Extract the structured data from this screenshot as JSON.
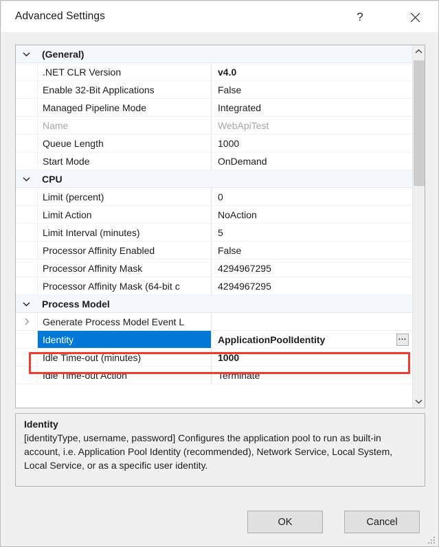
{
  "window": {
    "title": "Advanced Settings",
    "help_icon": "question-mark-icon",
    "close_icon": "close-icon"
  },
  "grid": {
    "rows": [
      {
        "type": "category",
        "expander": "chevron-down",
        "name": "(General)",
        "value": ""
      },
      {
        "type": "property",
        "name": ".NET CLR Version",
        "value": "v4.0",
        "bold": true
      },
      {
        "type": "property",
        "name": "Enable 32-Bit Applications",
        "value": "False"
      },
      {
        "type": "property",
        "name": "Managed Pipeline Mode",
        "value": "Integrated"
      },
      {
        "type": "property",
        "name": "Name",
        "value": "WebApiTest",
        "disabled": true
      },
      {
        "type": "property",
        "name": "Queue Length",
        "value": "1000"
      },
      {
        "type": "property",
        "name": "Start Mode",
        "value": "OnDemand"
      },
      {
        "type": "category",
        "expander": "chevron-down",
        "name": "CPU",
        "value": ""
      },
      {
        "type": "property",
        "name": "Limit (percent)",
        "value": "0"
      },
      {
        "type": "property",
        "name": "Limit Action",
        "value": "NoAction"
      },
      {
        "type": "property",
        "name": "Limit Interval (minutes)",
        "value": "5"
      },
      {
        "type": "property",
        "name": "Processor Affinity Enabled",
        "value": "False"
      },
      {
        "type": "property",
        "name": "Processor Affinity Mask",
        "value": "4294967295"
      },
      {
        "type": "property",
        "name": "Processor Affinity Mask (64-bit c",
        "value": "4294967295"
      },
      {
        "type": "category",
        "expander": "chevron-down",
        "name": "Process Model",
        "value": ""
      },
      {
        "type": "property",
        "expander": "chevron-right",
        "name": "Generate Process Model Event L",
        "value": ""
      },
      {
        "type": "property",
        "name": "Identity",
        "value": "ApplicationPoolIdentity",
        "selected": true,
        "bold": true,
        "ellipsis": "..."
      },
      {
        "type": "property",
        "name": "Idle Time-out (minutes)",
        "value": "1000",
        "bold": true
      },
      {
        "type": "property",
        "name": "Idle Time-out Action",
        "value": "Terminate"
      }
    ],
    "scrollbar": {
      "up_icon": "chevron-up-icon",
      "down_icon": "chevron-down-icon"
    }
  },
  "description": {
    "title": "Identity",
    "body": "[identityType, username, password] Configures the application pool to run as built-in account, i.e. Application Pool Identity (recommended), Network Service, Local System, Local Service, or as a specific user identity."
  },
  "footer": {
    "ok_label": "OK",
    "cancel_label": "Cancel"
  },
  "colors": {
    "selection": "#0078d7",
    "annotation": "#f23b30",
    "dialog_bg": "#f0f0f0",
    "category_bg": "#f4f7fb"
  }
}
